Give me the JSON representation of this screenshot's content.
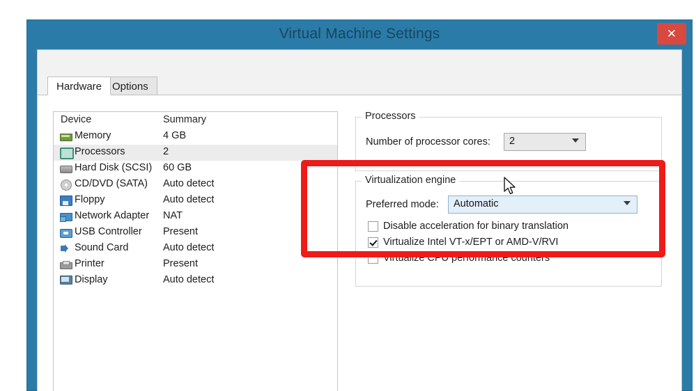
{
  "window": {
    "title": "Virtual Machine Settings",
    "close_label": "✕",
    "titlebar_color": "#2b7ba8",
    "close_color": "#d9493f"
  },
  "tabs": [
    {
      "label": "Hardware",
      "active": true
    },
    {
      "label": "Options",
      "active": false
    }
  ],
  "device_list": {
    "columns": {
      "device": "Device",
      "summary": "Summary"
    },
    "rows": [
      {
        "icon": "memory-icon",
        "name": "Memory",
        "summary": "4 GB",
        "selected": false
      },
      {
        "icon": "processor-icon",
        "name": "Processors",
        "summary": "2",
        "selected": true
      },
      {
        "icon": "hard-disk-icon",
        "name": "Hard Disk (SCSI)",
        "summary": "60 GB",
        "selected": false
      },
      {
        "icon": "cd-dvd-icon",
        "name": "CD/DVD (SATA)",
        "summary": "Auto detect",
        "selected": false
      },
      {
        "icon": "floppy-icon",
        "name": "Floppy",
        "summary": "Auto detect",
        "selected": false
      },
      {
        "icon": "network-adapter-icon",
        "name": "Network Adapter",
        "summary": "NAT",
        "selected": false
      },
      {
        "icon": "usb-controller-icon",
        "name": "USB Controller",
        "summary": "Present",
        "selected": false
      },
      {
        "icon": "sound-card-icon",
        "name": "Sound Card",
        "summary": "Auto detect",
        "selected": false
      },
      {
        "icon": "printer-icon",
        "name": "Printer",
        "summary": "Present",
        "selected": false
      },
      {
        "icon": "display-icon",
        "name": "Display",
        "summary": "Auto detect",
        "selected": false
      }
    ]
  },
  "processors_group": {
    "legend": "Processors",
    "cores_label": "Number of processor cores:",
    "cores_value": "2"
  },
  "virtualization_group": {
    "legend": "Virtualization engine",
    "preferred_mode_label": "Preferred mode:",
    "preferred_mode_value": "Automatic",
    "checkboxes": [
      {
        "label": "Disable acceleration for binary translation",
        "checked": false
      },
      {
        "label": "Virtualize Intel VT-x/EPT or AMD-V/RVI",
        "checked": true
      },
      {
        "label": "Virtualize CPU performance counters",
        "checked": false
      }
    ]
  },
  "annotation": {
    "color": "#ee1b18"
  }
}
